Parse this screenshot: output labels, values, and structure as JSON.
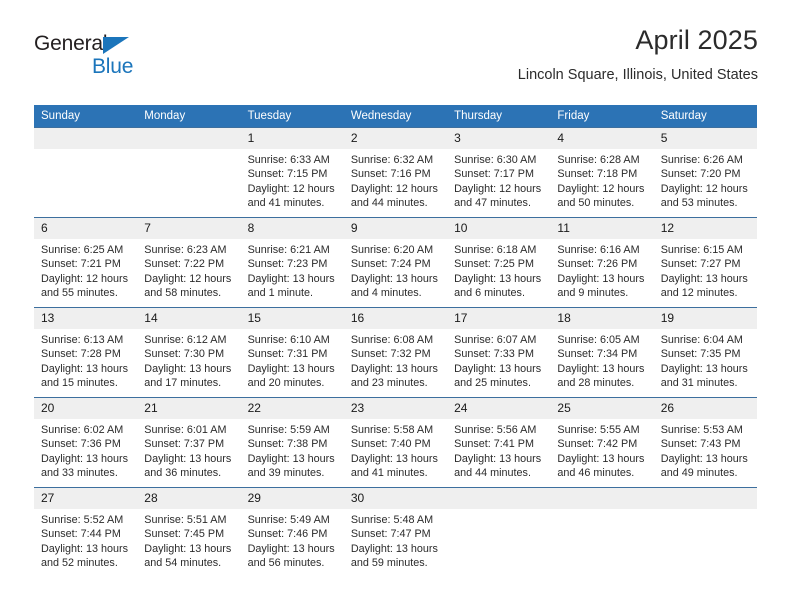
{
  "brand": {
    "name_part1": "General",
    "name_part2": "Blue",
    "color_dark": "#231f20",
    "color_blue": "#1b75bb"
  },
  "header": {
    "title": "April 2025",
    "subtitle": "Lincoln Square, Illinois, United States",
    "header_bg": "#2c73b5",
    "day_band_bg": "#efefef"
  },
  "calendar": {
    "weekday_headers": [
      "Sunday",
      "Monday",
      "Tuesday",
      "Wednesday",
      "Thursday",
      "Friday",
      "Saturday"
    ],
    "weeks": [
      [
        {
          "day": "",
          "empty": true
        },
        {
          "day": "",
          "empty": true
        },
        {
          "day": "1",
          "sunrise": "Sunrise: 6:33 AM",
          "sunset": "Sunset: 7:15 PM",
          "daylight": "Daylight: 12 hours and 41 minutes."
        },
        {
          "day": "2",
          "sunrise": "Sunrise: 6:32 AM",
          "sunset": "Sunset: 7:16 PM",
          "daylight": "Daylight: 12 hours and 44 minutes."
        },
        {
          "day": "3",
          "sunrise": "Sunrise: 6:30 AM",
          "sunset": "Sunset: 7:17 PM",
          "daylight": "Daylight: 12 hours and 47 minutes."
        },
        {
          "day": "4",
          "sunrise": "Sunrise: 6:28 AM",
          "sunset": "Sunset: 7:18 PM",
          "daylight": "Daylight: 12 hours and 50 minutes."
        },
        {
          "day": "5",
          "sunrise": "Sunrise: 6:26 AM",
          "sunset": "Sunset: 7:20 PM",
          "daylight": "Daylight: 12 hours and 53 minutes."
        }
      ],
      [
        {
          "day": "6",
          "sunrise": "Sunrise: 6:25 AM",
          "sunset": "Sunset: 7:21 PM",
          "daylight": "Daylight: 12 hours and 55 minutes."
        },
        {
          "day": "7",
          "sunrise": "Sunrise: 6:23 AM",
          "sunset": "Sunset: 7:22 PM",
          "daylight": "Daylight: 12 hours and 58 minutes."
        },
        {
          "day": "8",
          "sunrise": "Sunrise: 6:21 AM",
          "sunset": "Sunset: 7:23 PM",
          "daylight": "Daylight: 13 hours and 1 minute."
        },
        {
          "day": "9",
          "sunrise": "Sunrise: 6:20 AM",
          "sunset": "Sunset: 7:24 PM",
          "daylight": "Daylight: 13 hours and 4 minutes."
        },
        {
          "day": "10",
          "sunrise": "Sunrise: 6:18 AM",
          "sunset": "Sunset: 7:25 PM",
          "daylight": "Daylight: 13 hours and 6 minutes."
        },
        {
          "day": "11",
          "sunrise": "Sunrise: 6:16 AM",
          "sunset": "Sunset: 7:26 PM",
          "daylight": "Daylight: 13 hours and 9 minutes."
        },
        {
          "day": "12",
          "sunrise": "Sunrise: 6:15 AM",
          "sunset": "Sunset: 7:27 PM",
          "daylight": "Daylight: 13 hours and 12 minutes."
        }
      ],
      [
        {
          "day": "13",
          "sunrise": "Sunrise: 6:13 AM",
          "sunset": "Sunset: 7:28 PM",
          "daylight": "Daylight: 13 hours and 15 minutes."
        },
        {
          "day": "14",
          "sunrise": "Sunrise: 6:12 AM",
          "sunset": "Sunset: 7:30 PM",
          "daylight": "Daylight: 13 hours and 17 minutes."
        },
        {
          "day": "15",
          "sunrise": "Sunrise: 6:10 AM",
          "sunset": "Sunset: 7:31 PM",
          "daylight": "Daylight: 13 hours and 20 minutes."
        },
        {
          "day": "16",
          "sunrise": "Sunrise: 6:08 AM",
          "sunset": "Sunset: 7:32 PM",
          "daylight": "Daylight: 13 hours and 23 minutes."
        },
        {
          "day": "17",
          "sunrise": "Sunrise: 6:07 AM",
          "sunset": "Sunset: 7:33 PM",
          "daylight": "Daylight: 13 hours and 25 minutes."
        },
        {
          "day": "18",
          "sunrise": "Sunrise: 6:05 AM",
          "sunset": "Sunset: 7:34 PM",
          "daylight": "Daylight: 13 hours and 28 minutes."
        },
        {
          "day": "19",
          "sunrise": "Sunrise: 6:04 AM",
          "sunset": "Sunset: 7:35 PM",
          "daylight": "Daylight: 13 hours and 31 minutes."
        }
      ],
      [
        {
          "day": "20",
          "sunrise": "Sunrise: 6:02 AM",
          "sunset": "Sunset: 7:36 PM",
          "daylight": "Daylight: 13 hours and 33 minutes."
        },
        {
          "day": "21",
          "sunrise": "Sunrise: 6:01 AM",
          "sunset": "Sunset: 7:37 PM",
          "daylight": "Daylight: 13 hours and 36 minutes."
        },
        {
          "day": "22",
          "sunrise": "Sunrise: 5:59 AM",
          "sunset": "Sunset: 7:38 PM",
          "daylight": "Daylight: 13 hours and 39 minutes."
        },
        {
          "day": "23",
          "sunrise": "Sunrise: 5:58 AM",
          "sunset": "Sunset: 7:40 PM",
          "daylight": "Daylight: 13 hours and 41 minutes."
        },
        {
          "day": "24",
          "sunrise": "Sunrise: 5:56 AM",
          "sunset": "Sunset: 7:41 PM",
          "daylight": "Daylight: 13 hours and 44 minutes."
        },
        {
          "day": "25",
          "sunrise": "Sunrise: 5:55 AM",
          "sunset": "Sunset: 7:42 PM",
          "daylight": "Daylight: 13 hours and 46 minutes."
        },
        {
          "day": "26",
          "sunrise": "Sunrise: 5:53 AM",
          "sunset": "Sunset: 7:43 PM",
          "daylight": "Daylight: 13 hours and 49 minutes."
        }
      ],
      [
        {
          "day": "27",
          "sunrise": "Sunrise: 5:52 AM",
          "sunset": "Sunset: 7:44 PM",
          "daylight": "Daylight: 13 hours and 52 minutes."
        },
        {
          "day": "28",
          "sunrise": "Sunrise: 5:51 AM",
          "sunset": "Sunset: 7:45 PM",
          "daylight": "Daylight: 13 hours and 54 minutes."
        },
        {
          "day": "29",
          "sunrise": "Sunrise: 5:49 AM",
          "sunset": "Sunset: 7:46 PM",
          "daylight": "Daylight: 13 hours and 56 minutes."
        },
        {
          "day": "30",
          "sunrise": "Sunrise: 5:48 AM",
          "sunset": "Sunset: 7:47 PM",
          "daylight": "Daylight: 13 hours and 59 minutes."
        },
        {
          "day": "",
          "empty": true
        },
        {
          "day": "",
          "empty": true
        },
        {
          "day": "",
          "empty": true
        }
      ]
    ]
  }
}
